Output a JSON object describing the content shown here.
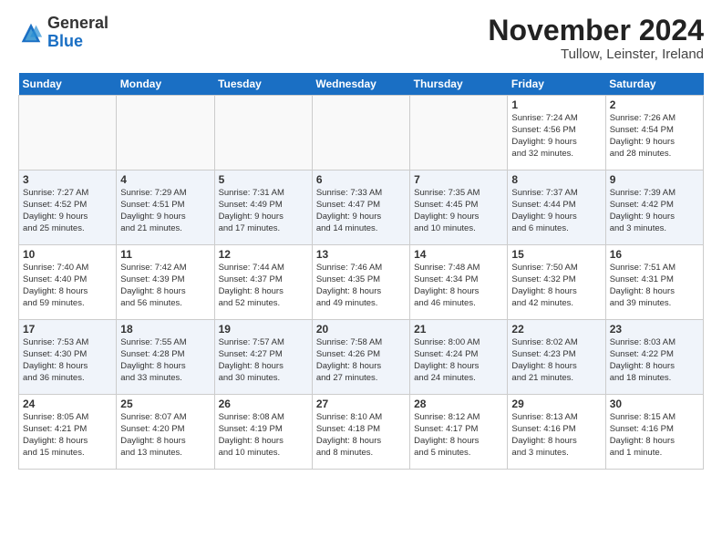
{
  "logo": {
    "general": "General",
    "blue": "Blue"
  },
  "title": "November 2024",
  "location": "Tullow, Leinster, Ireland",
  "days_of_week": [
    "Sunday",
    "Monday",
    "Tuesday",
    "Wednesday",
    "Thursday",
    "Friday",
    "Saturday"
  ],
  "weeks": [
    {
      "row_class": "row-white",
      "days": [
        {
          "num": "",
          "info": "",
          "empty": true
        },
        {
          "num": "",
          "info": "",
          "empty": true
        },
        {
          "num": "",
          "info": "",
          "empty": true
        },
        {
          "num": "",
          "info": "",
          "empty": true
        },
        {
          "num": "",
          "info": "",
          "empty": true
        },
        {
          "num": "1",
          "info": "Sunrise: 7:24 AM\nSunset: 4:56 PM\nDaylight: 9 hours\nand 32 minutes.",
          "empty": false
        },
        {
          "num": "2",
          "info": "Sunrise: 7:26 AM\nSunset: 4:54 PM\nDaylight: 9 hours\nand 28 minutes.",
          "empty": false
        }
      ]
    },
    {
      "row_class": "row-blue",
      "days": [
        {
          "num": "3",
          "info": "Sunrise: 7:27 AM\nSunset: 4:52 PM\nDaylight: 9 hours\nand 25 minutes.",
          "empty": false
        },
        {
          "num": "4",
          "info": "Sunrise: 7:29 AM\nSunset: 4:51 PM\nDaylight: 9 hours\nand 21 minutes.",
          "empty": false
        },
        {
          "num": "5",
          "info": "Sunrise: 7:31 AM\nSunset: 4:49 PM\nDaylight: 9 hours\nand 17 minutes.",
          "empty": false
        },
        {
          "num": "6",
          "info": "Sunrise: 7:33 AM\nSunset: 4:47 PM\nDaylight: 9 hours\nand 14 minutes.",
          "empty": false
        },
        {
          "num": "7",
          "info": "Sunrise: 7:35 AM\nSunset: 4:45 PM\nDaylight: 9 hours\nand 10 minutes.",
          "empty": false
        },
        {
          "num": "8",
          "info": "Sunrise: 7:37 AM\nSunset: 4:44 PM\nDaylight: 9 hours\nand 6 minutes.",
          "empty": false
        },
        {
          "num": "9",
          "info": "Sunrise: 7:39 AM\nSunset: 4:42 PM\nDaylight: 9 hours\nand 3 minutes.",
          "empty": false
        }
      ]
    },
    {
      "row_class": "row-white",
      "days": [
        {
          "num": "10",
          "info": "Sunrise: 7:40 AM\nSunset: 4:40 PM\nDaylight: 8 hours\nand 59 minutes.",
          "empty": false
        },
        {
          "num": "11",
          "info": "Sunrise: 7:42 AM\nSunset: 4:39 PM\nDaylight: 8 hours\nand 56 minutes.",
          "empty": false
        },
        {
          "num": "12",
          "info": "Sunrise: 7:44 AM\nSunset: 4:37 PM\nDaylight: 8 hours\nand 52 minutes.",
          "empty": false
        },
        {
          "num": "13",
          "info": "Sunrise: 7:46 AM\nSunset: 4:35 PM\nDaylight: 8 hours\nand 49 minutes.",
          "empty": false
        },
        {
          "num": "14",
          "info": "Sunrise: 7:48 AM\nSunset: 4:34 PM\nDaylight: 8 hours\nand 46 minutes.",
          "empty": false
        },
        {
          "num": "15",
          "info": "Sunrise: 7:50 AM\nSunset: 4:32 PM\nDaylight: 8 hours\nand 42 minutes.",
          "empty": false
        },
        {
          "num": "16",
          "info": "Sunrise: 7:51 AM\nSunset: 4:31 PM\nDaylight: 8 hours\nand 39 minutes.",
          "empty": false
        }
      ]
    },
    {
      "row_class": "row-blue",
      "days": [
        {
          "num": "17",
          "info": "Sunrise: 7:53 AM\nSunset: 4:30 PM\nDaylight: 8 hours\nand 36 minutes.",
          "empty": false
        },
        {
          "num": "18",
          "info": "Sunrise: 7:55 AM\nSunset: 4:28 PM\nDaylight: 8 hours\nand 33 minutes.",
          "empty": false
        },
        {
          "num": "19",
          "info": "Sunrise: 7:57 AM\nSunset: 4:27 PM\nDaylight: 8 hours\nand 30 minutes.",
          "empty": false
        },
        {
          "num": "20",
          "info": "Sunrise: 7:58 AM\nSunset: 4:26 PM\nDaylight: 8 hours\nand 27 minutes.",
          "empty": false
        },
        {
          "num": "21",
          "info": "Sunrise: 8:00 AM\nSunset: 4:24 PM\nDaylight: 8 hours\nand 24 minutes.",
          "empty": false
        },
        {
          "num": "22",
          "info": "Sunrise: 8:02 AM\nSunset: 4:23 PM\nDaylight: 8 hours\nand 21 minutes.",
          "empty": false
        },
        {
          "num": "23",
          "info": "Sunrise: 8:03 AM\nSunset: 4:22 PM\nDaylight: 8 hours\nand 18 minutes.",
          "empty": false
        }
      ]
    },
    {
      "row_class": "row-white",
      "days": [
        {
          "num": "24",
          "info": "Sunrise: 8:05 AM\nSunset: 4:21 PM\nDaylight: 8 hours\nand 15 minutes.",
          "empty": false
        },
        {
          "num": "25",
          "info": "Sunrise: 8:07 AM\nSunset: 4:20 PM\nDaylight: 8 hours\nand 13 minutes.",
          "empty": false
        },
        {
          "num": "26",
          "info": "Sunrise: 8:08 AM\nSunset: 4:19 PM\nDaylight: 8 hours\nand 10 minutes.",
          "empty": false
        },
        {
          "num": "27",
          "info": "Sunrise: 8:10 AM\nSunset: 4:18 PM\nDaylight: 8 hours\nand 8 minutes.",
          "empty": false
        },
        {
          "num": "28",
          "info": "Sunrise: 8:12 AM\nSunset: 4:17 PM\nDaylight: 8 hours\nand 5 minutes.",
          "empty": false
        },
        {
          "num": "29",
          "info": "Sunrise: 8:13 AM\nSunset: 4:16 PM\nDaylight: 8 hours\nand 3 minutes.",
          "empty": false
        },
        {
          "num": "30",
          "info": "Sunrise: 8:15 AM\nSunset: 4:16 PM\nDaylight: 8 hours\nand 1 minute.",
          "empty": false
        }
      ]
    }
  ]
}
